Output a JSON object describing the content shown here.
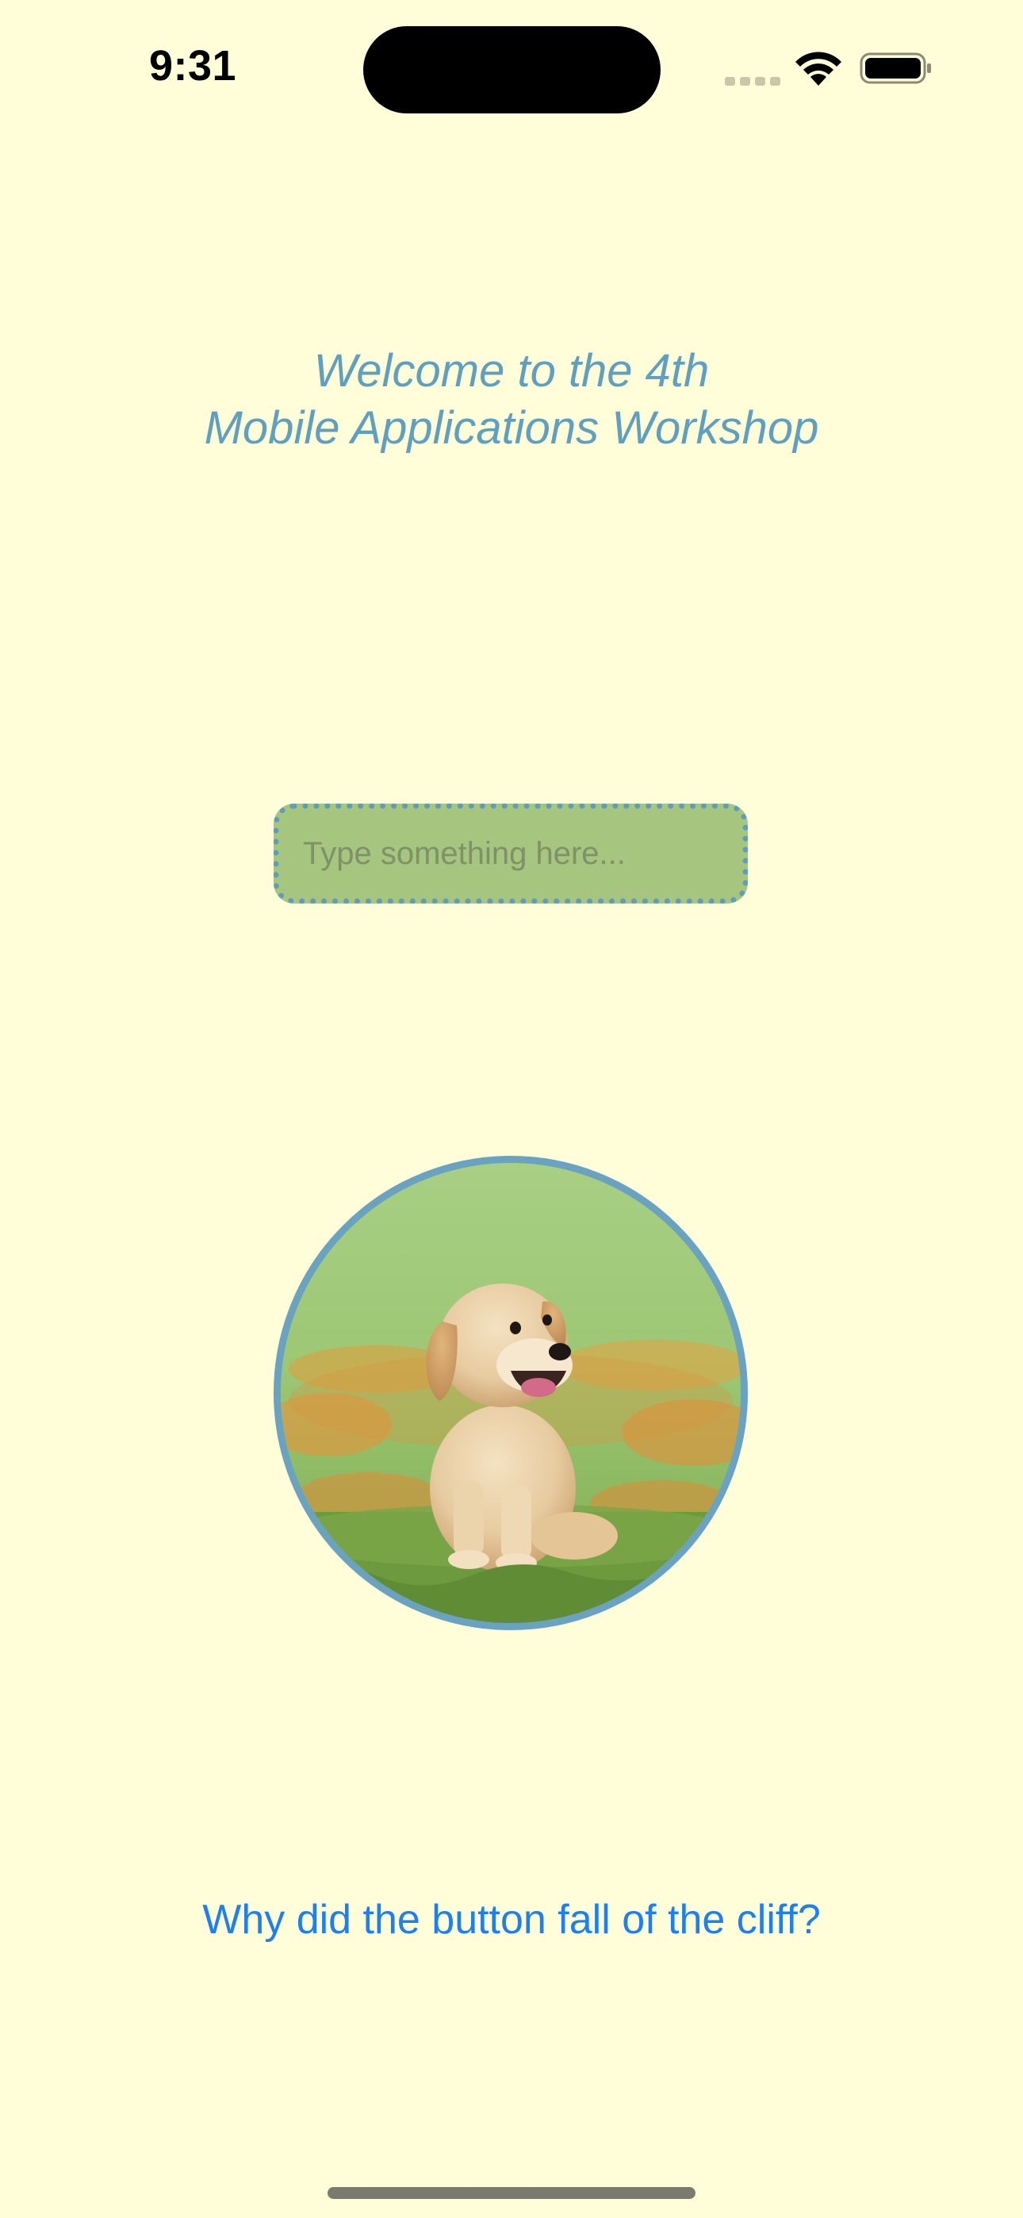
{
  "status_bar": {
    "time": "9:31",
    "icons": [
      "cellular-signal-icon",
      "wifi-icon",
      "battery-icon"
    ]
  },
  "header": {
    "title_line1": "Welcome to the 4th",
    "title_line2": "Mobile Applications Workshop"
  },
  "input": {
    "placeholder": "Type something here...",
    "value": ""
  },
  "image": {
    "description_icon": "puppy-photo"
  },
  "button": {
    "label": "Why did the button fall of the cliff?"
  },
  "colors": {
    "background": "#FFFED8",
    "title": "#5F9FBF",
    "field_fill": "#A6C57E",
    "field_border": "#5D9EBD",
    "photo_border": "#6AA2C1",
    "button_text": "#1E7FF2"
  }
}
